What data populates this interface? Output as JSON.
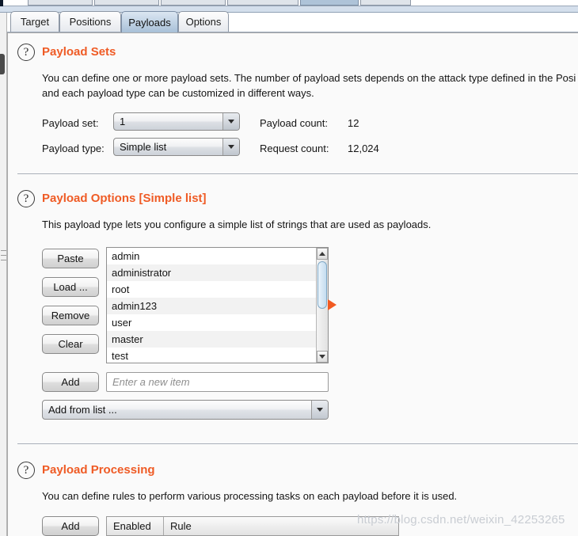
{
  "window": {
    "top_tab_strip_selected_index": 4
  },
  "tabs": [
    {
      "label": "Target",
      "selected": false
    },
    {
      "label": "Positions",
      "selected": false
    },
    {
      "label": "Payloads",
      "selected": true
    },
    {
      "label": "Options",
      "selected": false
    }
  ],
  "payload_sets": {
    "help_icon": "question-circle-icon",
    "title": "Payload Sets",
    "description_line1": "You can define one or more payload sets. The number of payload sets depends on the attack type defined in the Posi",
    "description_line2": "and each payload type can be customized in different ways.",
    "payload_set_label": "Payload set:",
    "payload_set_value": "1",
    "payload_type_label": "Payload type:",
    "payload_type_value": "Simple list",
    "payload_count_label": "Payload count:",
    "payload_count_value": "12",
    "request_count_label": "Request count:",
    "request_count_value": "12,024"
  },
  "payload_options": {
    "help_icon": "question-circle-icon",
    "title": "Payload Options [Simple list]",
    "description": "This payload type lets you configure a simple list of strings that are used as payloads.",
    "buttons": [
      {
        "label": "Paste"
      },
      {
        "label": "Load ..."
      },
      {
        "label": "Remove"
      },
      {
        "label": "Clear"
      }
    ],
    "items": [
      "admin",
      "administrator",
      "root",
      "admin123",
      "user",
      "master",
      "test"
    ],
    "scrollbar": {
      "up_icon": "caret-up-icon",
      "down_icon": "caret-down-icon"
    },
    "cursor_icon": "orange-pointer-arrow-icon",
    "add_button_label": "Add",
    "new_item_placeholder": "Enter a new item",
    "new_item_value": "",
    "add_from_list_value": "Add from list ...",
    "dropdown_icon": "chevron-down-icon"
  },
  "payload_processing": {
    "help_icon": "question-circle-icon",
    "title": "Payload Processing",
    "description": "You can define rules to perform various processing tasks on each payload before it is used.",
    "add_button_label": "Add",
    "columns": [
      "Enabled",
      "Rule"
    ]
  },
  "watermark": {
    "text": "https://blog.csdn.net/weixin_42253265"
  },
  "colors": {
    "accent_orange": "#ef5b25",
    "selected_tab": "#a8c0d8",
    "panel_bg": "#fafafa",
    "cursor_orange": "#f15a22"
  }
}
